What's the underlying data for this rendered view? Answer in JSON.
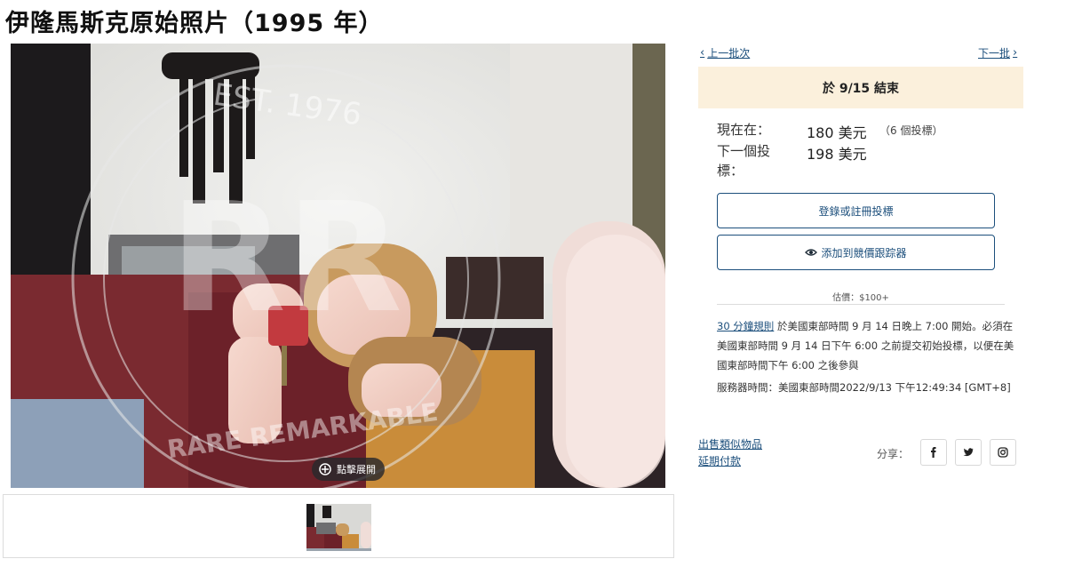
{
  "page": {
    "title": "伊隆馬斯克原始照片（1995 年）"
  },
  "gallery": {
    "expand_label": "點擊展開",
    "watermark_line1": "EST. 1976",
    "watermark_line2": "RARE REMARKABLE",
    "watermark_monogram": "RR",
    "thumbnail_count": 1
  },
  "nav": {
    "prev_label": "上一批次",
    "next_label": "下一批"
  },
  "auction": {
    "end_banner": "於 9/15 結束",
    "current_label": "現在在：",
    "current_value": "180 美元",
    "bid_count": "（6 個投標）",
    "next_bid_label": "下一個投標：",
    "next_bid_value": "198 美元",
    "register_button": "登錄或註冊投標",
    "tracker_button": "添加到競價跟踪器",
    "estimate": "估價：$100+",
    "rule_link": "30 分鐘規則",
    "rule_text": "於美國東部時間 9 月 14 日晚上 7:00 開始。必須在美國東部時間 9 月 14 日下午 6:00 之前提交初始投標，以便在美國東部時間下午 6:00 之後參與",
    "server_time": "服務器時間：美國東部時間2022/9/13 下午12:49:34 [GMT+8]"
  },
  "links": {
    "similar_items": "出售類似物品",
    "deferred_payment": "延期付款"
  },
  "share": {
    "label": "分享：",
    "icons": [
      "facebook-icon",
      "twitter-icon",
      "instagram-icon"
    ]
  },
  "colors": {
    "accent": "#1c4f7c",
    "banner_bg": "#fbf0dc"
  }
}
